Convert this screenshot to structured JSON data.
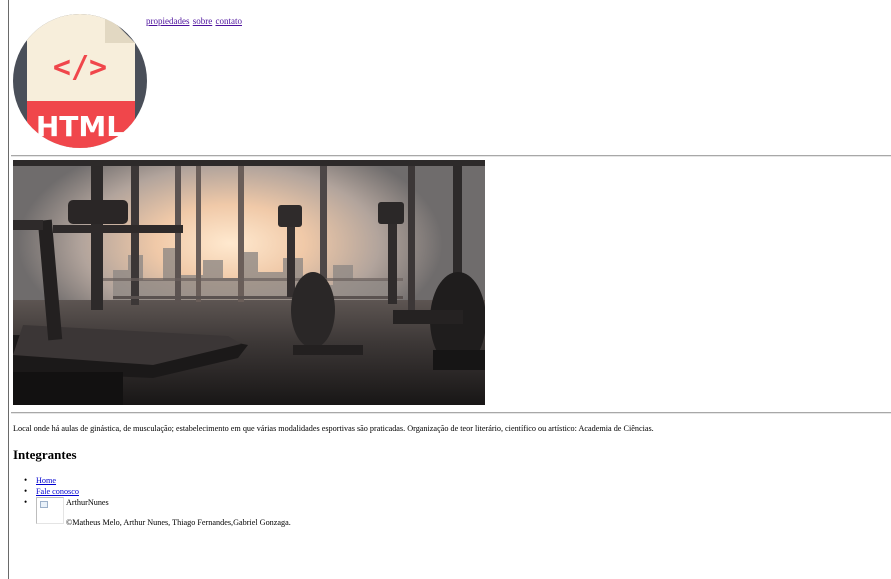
{
  "header": {
    "logo_label": "HTML",
    "logo_code": "</>",
    "nav": [
      "propiedades",
      "sobre",
      "contato"
    ]
  },
  "content": {
    "description": "Local onde há aulas de ginástica, de musculação; estabelecimento em que várias modalidades esportivas são praticadas. Organização de teor literário, científico ou artístico: Academia de Ciências.",
    "members_heading": "Integrantes",
    "links": [
      "Home",
      "Fale conosco"
    ],
    "member_name": "ArthurNunes",
    "footer": "©Matheus Melo, Arthur Nunes, Thiago Fernandes,Gabriel Gonzaga."
  },
  "colors": {
    "logo_circle": "#4a4f59",
    "logo_sheet": "#f7eedb",
    "logo_accent": "#f0464b",
    "link": "#0000d0",
    "visited_link": "#4b0f9c"
  },
  "icons": {
    "logo": "html-file-icon",
    "broken_image": "broken-image-icon"
  }
}
